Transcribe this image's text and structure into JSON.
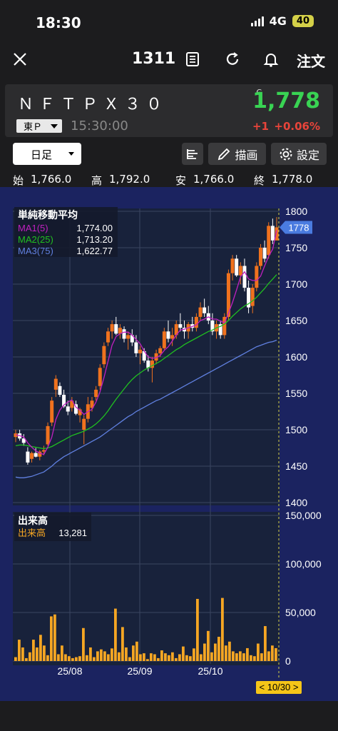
{
  "status": {
    "time": "18:30",
    "network": "4G",
    "battery": "40"
  },
  "nav": {
    "code": "1311",
    "order_label": "注文"
  },
  "quote": {
    "name": "ＮＦＴＰＸ３０",
    "market": "東Ｐ",
    "time": "15:30:00",
    "c_mark": "C",
    "price": "1,778",
    "change": "+1",
    "change_pct": "+0.06%"
  },
  "controls": {
    "period": "日足",
    "draw_label": "描画",
    "settings_label": "設定"
  },
  "ohlc": {
    "open_label": "始",
    "open": "1,766.0",
    "high_label": "高",
    "high": "1,792.0",
    "low_label": "安",
    "low": "1,766.0",
    "close_label": "終",
    "close": "1,778.0"
  },
  "colors": {
    "up": "#f0721e",
    "down": "#ffffff",
    "ma1": "#c020c0",
    "ma2": "#20c020",
    "ma3": "#6080e0",
    "volume": "#f5a623",
    "bg": "#1b2360",
    "price_tag": "#4a7be0"
  },
  "chart_data": [
    {
      "type": "candlestick",
      "legend_title": "単純移動平均",
      "legend": [
        {
          "name": "MA1(5)",
          "value": "1,774.00"
        },
        {
          "name": "MA2(25)",
          "value": "1,713.20"
        },
        {
          "name": "MA3(75)",
          "value": "1,622.77"
        }
      ],
      "yticks": [
        "1800",
        "1750",
        "1700",
        "1650",
        "1600",
        "1550",
        "1500",
        "1450",
        "1400"
      ],
      "ylim": [
        1400,
        1800
      ],
      "last_price": "1778",
      "xticks": [
        "25/08",
        "25/09",
        "25/10"
      ],
      "cursor_label": "< 10/30 >",
      "candles": [
        [
          1490,
          1500,
          1483,
          1495
        ],
        [
          1495,
          1500,
          1485,
          1488
        ],
        [
          1488,
          1494,
          1478,
          1482
        ],
        [
          1470,
          1476,
          1452,
          1455
        ],
        [
          1460,
          1470,
          1455,
          1468
        ],
        [
          1468,
          1475,
          1462,
          1463
        ],
        [
          1463,
          1472,
          1458,
          1470
        ],
        [
          1470,
          1478,
          1465,
          1472
        ],
        [
          1480,
          1510,
          1478,
          1505
        ],
        [
          1510,
          1545,
          1505,
          1540
        ],
        [
          1555,
          1575,
          1545,
          1570
        ],
        [
          1560,
          1565,
          1545,
          1548
        ],
        [
          1548,
          1555,
          1530,
          1532
        ],
        [
          1532,
          1540,
          1520,
          1525
        ],
        [
          1530,
          1545,
          1525,
          1540
        ],
        [
          1535,
          1540,
          1520,
          1522
        ],
        [
          1520,
          1530,
          1510,
          1528
        ],
        [
          1500,
          1520,
          1480,
          1515
        ],
        [
          1515,
          1545,
          1510,
          1535
        ],
        [
          1530,
          1545,
          1525,
          1540
        ],
        [
          1545,
          1560,
          1540,
          1555
        ],
        [
          1560,
          1590,
          1555,
          1585
        ],
        [
          1590,
          1620,
          1585,
          1615
        ],
        [
          1620,
          1640,
          1615,
          1635
        ],
        [
          1635,
          1650,
          1625,
          1645
        ],
        [
          1645,
          1655,
          1630,
          1632
        ],
        [
          1632,
          1645,
          1625,
          1640
        ],
        [
          1638,
          1642,
          1620,
          1625
        ],
        [
          1625,
          1635,
          1610,
          1630
        ],
        [
          1630,
          1638,
          1615,
          1620
        ],
        [
          1620,
          1630,
          1600,
          1605
        ],
        [
          1605,
          1615,
          1590,
          1610
        ],
        [
          1608,
          1612,
          1592,
          1595
        ],
        [
          1595,
          1602,
          1580,
          1585
        ],
        [
          1585,
          1600,
          1565,
          1595
        ],
        [
          1595,
          1610,
          1590,
          1605
        ],
        [
          1605,
          1615,
          1600,
          1612
        ],
        [
          1612,
          1640,
          1610,
          1635
        ],
        [
          1635,
          1650,
          1620,
          1625
        ],
        [
          1625,
          1640,
          1615,
          1630
        ],
        [
          1630,
          1650,
          1625,
          1645
        ],
        [
          1645,
          1660,
          1635,
          1640
        ],
        [
          1640,
          1650,
          1625,
          1635
        ],
        [
          1635,
          1648,
          1625,
          1645
        ],
        [
          1645,
          1655,
          1635,
          1640
        ],
        [
          1640,
          1660,
          1635,
          1655
        ],
        [
          1655,
          1675,
          1650,
          1668
        ],
        [
          1668,
          1680,
          1655,
          1660
        ],
        [
          1660,
          1670,
          1645,
          1650
        ],
        [
          1650,
          1660,
          1630,
          1635
        ],
        [
          1635,
          1650,
          1625,
          1645
        ],
        [
          1645,
          1650,
          1625,
          1630
        ],
        [
          1630,
          1660,
          1625,
          1655
        ],
        [
          1655,
          1720,
          1650,
          1715
        ],
        [
          1715,
          1740,
          1705,
          1735
        ],
        [
          1735,
          1740,
          1710,
          1712
        ],
        [
          1712,
          1730,
          1700,
          1725
        ],
        [
          1725,
          1735,
          1690,
          1695
        ],
        [
          1695,
          1705,
          1660,
          1668
        ],
        [
          1670,
          1700,
          1660,
          1695
        ],
        [
          1695,
          1730,
          1690,
          1725
        ],
        [
          1725,
          1755,
          1720,
          1750
        ],
        [
          1750,
          1760,
          1730,
          1735
        ],
        [
          1740,
          1785,
          1735,
          1780
        ],
        [
          1780,
          1790,
          1755,
          1760
        ],
        [
          1760,
          1792,
          1760,
          1778
        ]
      ],
      "ma1": [
        1493,
        1492,
        1490,
        1482,
        1476,
        1471,
        1468,
        1466,
        1476,
        1490,
        1514,
        1527,
        1534,
        1538,
        1541,
        1531,
        1527,
        1521,
        1525,
        1528,
        1538,
        1552,
        1572,
        1594,
        1616,
        1628,
        1632,
        1634,
        1634,
        1630,
        1624,
        1618,
        1608,
        1600,
        1598,
        1599,
        1602,
        1609,
        1614,
        1622,
        1630,
        1637,
        1638,
        1640,
        1642,
        1644,
        1650,
        1652,
        1655,
        1652,
        1652,
        1649,
        1647,
        1660,
        1675,
        1692,
        1710,
        1717,
        1707,
        1705,
        1705,
        1711,
        1725,
        1738,
        1748,
        1774
      ],
      "ma2": [
        1478,
        1479,
        1479,
        1478,
        1477,
        1476,
        1475,
        1474,
        1475,
        1477,
        1480,
        1483,
        1486,
        1489,
        1492,
        1494,
        1496,
        1498,
        1501,
        1504,
        1508,
        1513,
        1519,
        1526,
        1534,
        1542,
        1549,
        1556,
        1563,
        1569,
        1574,
        1578,
        1582,
        1585,
        1588,
        1591,
        1594,
        1598,
        1602,
        1606,
        1610,
        1613,
        1617,
        1620,
        1623,
        1626,
        1629,
        1632,
        1635,
        1637,
        1640,
        1642,
        1645,
        1650,
        1656,
        1661,
        1666,
        1670,
        1673,
        1677,
        1682,
        1688,
        1694,
        1701,
        1707,
        1713
      ],
      "ma3": [
        1435,
        1434,
        1434,
        1435,
        1436,
        1438,
        1440,
        1442,
        1446,
        1450,
        1455,
        1459,
        1463,
        1466,
        1469,
        1472,
        1475,
        1478,
        1481,
        1484,
        1487,
        1490,
        1494,
        1498,
        1502,
        1506,
        1510,
        1514,
        1518,
        1521,
        1525,
        1528,
        1531,
        1534,
        1537,
        1540,
        1542,
        1545,
        1548,
        1551,
        1554,
        1557,
        1560,
        1563,
        1566,
        1569,
        1572,
        1575,
        1578,
        1581,
        1584,
        1587,
        1590,
        1593,
        1596,
        1599,
        1602,
        1605,
        1608,
        1611,
        1614,
        1616,
        1618,
        1620,
        1621,
        1623
      ]
    },
    {
      "type": "bar",
      "legend_title": "出来高",
      "legend": [
        {
          "name": "出来高",
          "value": "13,281"
        }
      ],
      "yticks": [
        "150,000",
        "100,000",
        "50,000",
        "0"
      ],
      "ylim": [
        0,
        150000
      ],
      "values": [
        4000,
        22000,
        14000,
        3000,
        9000,
        22000,
        14000,
        27000,
        16000,
        6000,
        46000,
        48000,
        7000,
        16000,
        7000,
        5000,
        3000,
        4000,
        5000,
        34000,
        6000,
        14000,
        4000,
        10000,
        12000,
        10000,
        7000,
        13000,
        54000,
        9000,
        35000,
        14000,
        4000,
        16000,
        20000,
        7000,
        8000,
        2000,
        8000,
        7000,
        3000,
        11000,
        8000,
        6000,
        9000,
        3000,
        7000,
        15000,
        6000,
        5000,
        13000,
        64000,
        7000,
        18000,
        31000,
        9000,
        18000,
        25000,
        65000,
        16000,
        20000,
        10000,
        8000,
        10000,
        8000,
        13281,
        6000,
        5000,
        18000,
        8000,
        36000,
        10000,
        16000,
        13281
      ]
    }
  ]
}
